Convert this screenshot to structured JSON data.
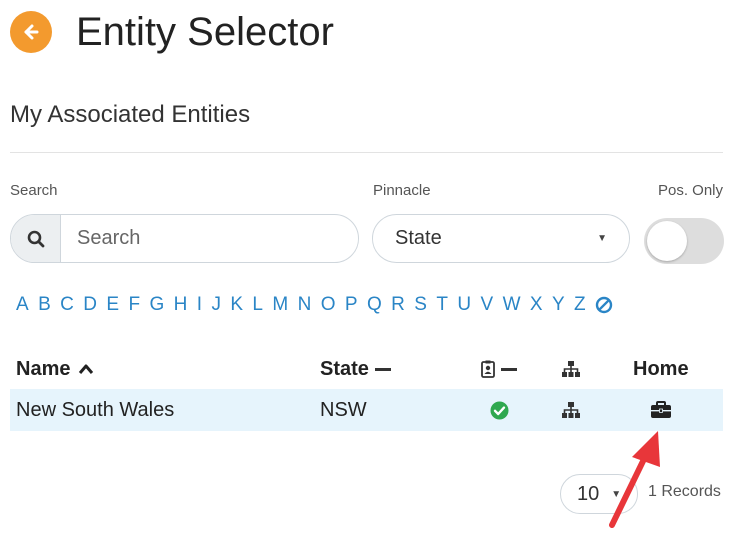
{
  "header": {
    "title": "Entity Selector"
  },
  "section": {
    "title": "My Associated Entities"
  },
  "filters": {
    "search_label": "Search",
    "search_placeholder": "Search",
    "pinnacle_label": "Pinnacle",
    "pinnacle_value": "State",
    "pos_only_label": "Pos. Only",
    "pos_only_on": false
  },
  "alphabet": [
    "A",
    "B",
    "C",
    "D",
    "E",
    "F",
    "G",
    "H",
    "I",
    "J",
    "K",
    "L",
    "M",
    "N",
    "O",
    "P",
    "Q",
    "R",
    "S",
    "T",
    "U",
    "V",
    "W",
    "X",
    "Y",
    "Z"
  ],
  "table": {
    "columns": {
      "name": "Name",
      "state": "State",
      "home": "Home"
    },
    "rows": [
      {
        "name": "New South Wales",
        "state": "NSW"
      }
    ]
  },
  "pagination": {
    "page_size": "10",
    "records_text": "1 Records"
  },
  "colors": {
    "accent_orange": "#f39a2e",
    "link_blue": "#2a85c6",
    "check_green": "#2fa84f",
    "row_highlight": "#e6f4fc",
    "annotation_red": "#e8363a"
  },
  "icons": [
    "back-arrow-icon",
    "search-icon",
    "sort-asc-icon",
    "id-badge-icon",
    "hierarchy-icon",
    "check-circle-icon",
    "briefcase-icon",
    "clear-filter-icon"
  ]
}
